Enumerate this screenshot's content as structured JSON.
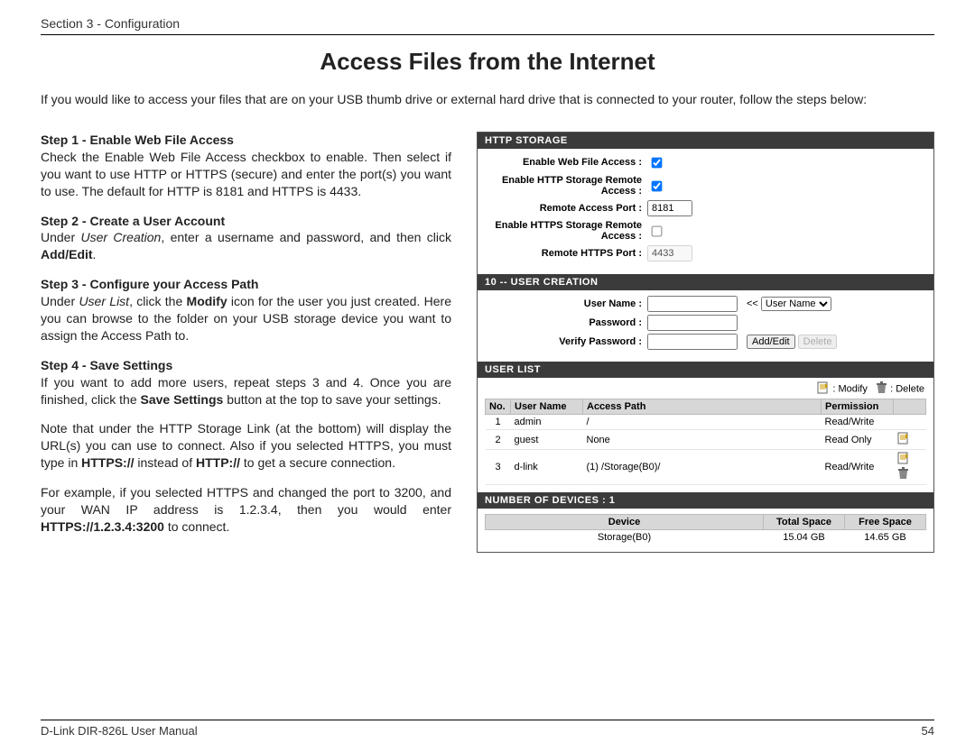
{
  "header": {
    "section": "Section 3 - Configuration"
  },
  "title": "Access Files from the Internet",
  "intro": "If you would like to access your files that are on your USB thumb drive or external hard drive that is connected to your router, follow the steps below:",
  "steps": {
    "s1_title": "Step 1 - Enable Web File Access",
    "s1_body": "Check the Enable Web File Access checkbox to enable. Then select if you want to use HTTP or HTTPS (secure) and enter the port(s) you want to use. The default for HTTP is 8181 and HTTPS is 4433.",
    "s2_title": "Step 2 - Create a User Account",
    "s2_pre": "Under ",
    "s2_ital": "User Creation",
    "s2_mid": ", enter a username and password, and then click ",
    "s2_bold": "Add/Edit",
    "s2_end": ".",
    "s3_title": "Step 3 - Configure your Access Path",
    "s3_pre": "Under ",
    "s3_ital": "User List",
    "s3_mid1": ", click the ",
    "s3_bold": "Modify",
    "s3_mid2": " icon for the user you just created. Here you can browse to the folder on your USB storage device you want to assign the Access Path to.",
    "s4_title": "Step 4 - Save Settings",
    "s4_p1_pre": "If you want to add more users, repeat steps 3 and 4. Once you are finished, click the ",
    "s4_p1_bold": "Save Settings",
    "s4_p1_post": " button at the top to save your settings.",
    "s4_p2_pre": "Note that under the HTTP Storage Link (at the bottom) will display the URL(s) you can use to connect. Also if you selected HTTPS, you must type in ",
    "s4_p2_b1": "HTTPS://",
    "s4_p2_mid": " instead of ",
    "s4_p2_b2": "HTTP://",
    "s4_p2_post": " to get a secure connection.",
    "s4_p3_pre": "For example, if you selected HTTPS and changed the port to 3200, and your WAN IP address is 1.2.3.4, then you would enter ",
    "s4_p3_bold": "HTTPS://1.2.3.4:3200",
    "s4_p3_post": " to connect."
  },
  "panel": {
    "http_storage_bar": "HTTP STORAGE",
    "enable_web_file_access_label": "Enable Web File Access :",
    "enable_http_remote_label": "Enable HTTP Storage Remote Access :",
    "remote_access_port_label": "Remote Access Port :",
    "remote_access_port_value": "8181",
    "enable_https_remote_label": "Enable HTTPS Storage Remote Access :",
    "remote_https_port_label": "Remote HTTPS Port :",
    "remote_https_port_value": "4433",
    "user_creation_bar": "10 -- USER CREATION",
    "user_name_label": "User Name :",
    "password_label": "Password :",
    "verify_password_label": "Verify Password :",
    "arrows": "<<",
    "user_select_option": "User Name",
    "addedit_btn": "Add/Edit",
    "delete_btn": "Delete",
    "user_list_bar": "USER LIST",
    "legend_modify": ": Modify",
    "legend_delete": ": Delete",
    "ul_headers": {
      "no": "No.",
      "user": "User Name",
      "path": "Access Path",
      "perm": "Permission"
    },
    "users": [
      {
        "no": "1",
        "name": "admin",
        "path": "/",
        "perm": "Read/Write",
        "editable": false
      },
      {
        "no": "2",
        "name": "guest",
        "path": "None",
        "perm": "Read Only",
        "editable": true,
        "deletable": false
      },
      {
        "no": "3",
        "name": "d-link",
        "path": "(1) /Storage(B0)/",
        "perm": "Read/Write",
        "editable": true,
        "deletable": true
      }
    ],
    "devices_bar": "NUMBER OF DEVICES : 1",
    "dev_headers": {
      "device": "Device",
      "total": "Total Space",
      "free": "Free Space"
    },
    "devices": [
      {
        "device": "Storage(B0)",
        "total": "15.04 GB",
        "free": "14.65 GB"
      }
    ]
  },
  "footer": {
    "manual": "D-Link DIR-826L User Manual",
    "page": "54"
  }
}
